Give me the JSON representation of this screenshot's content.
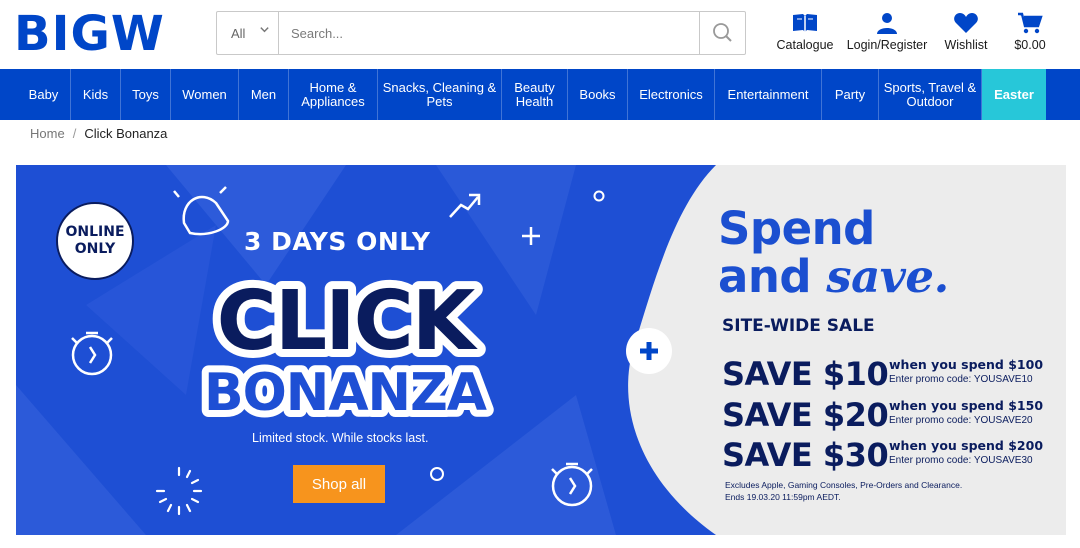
{
  "header": {
    "logo": "BIGW",
    "search": {
      "category": "All",
      "placeholder": "Search..."
    },
    "icons": [
      {
        "label": "Catalogue",
        "icon": "catalogue-book-icon"
      },
      {
        "label": "Login/Register",
        "icon": "user-icon"
      },
      {
        "label": "Wishlist",
        "icon": "heart-icon"
      },
      {
        "label": "$0.00",
        "icon": "cart-icon"
      }
    ]
  },
  "nav": {
    "items": [
      "Baby",
      "Kids",
      "Toys",
      "Women",
      "Men",
      "Home & Appliances",
      "Snacks, Cleaning & Pets",
      "Beauty Health",
      "Books",
      "Electronics",
      "Entertainment",
      "Party",
      "Sports, Travel & Outdoor",
      "Easter"
    ]
  },
  "breadcrumb": {
    "home": "Home",
    "separator": "/",
    "current": "Click Bonanza"
  },
  "banner": {
    "badge": "ONLINE ONLY",
    "days": "3 DAYS ONLY",
    "title_line1": "CLICK",
    "title_line2": "BONANZA",
    "limited": "Limited stock. While stocks last.",
    "shop_button": "Shop all",
    "spend_line1": "Spend",
    "spend_and": "and",
    "spend_save": "save.",
    "sitewide": "SITE-WIDE SALE",
    "offers": [
      {
        "amount": "SAVE $10",
        "when": "when you spend $100",
        "code": "Enter promo code: YOUSAVE10"
      },
      {
        "amount": "SAVE $20",
        "when": "when you spend $150",
        "code": "Enter promo code: YOUSAVE20"
      },
      {
        "amount": "SAVE $30",
        "when": "when you spend $200",
        "code": "Enter promo code: YOUSAVE30"
      }
    ],
    "fine_print_1": "Excludes Apple, Gaming Consoles, Pre-Orders and Clearance.",
    "fine_print_2": "Ends 19.03.20 11:59pm AEDT."
  },
  "colors": {
    "brand_blue": "#0046c8",
    "banner_blue": "#1e4fd4",
    "navy": "#0a1c5e",
    "easter_teal": "#27c7d9",
    "shop_orange": "#f7941d",
    "panel_grey": "#ececec"
  }
}
